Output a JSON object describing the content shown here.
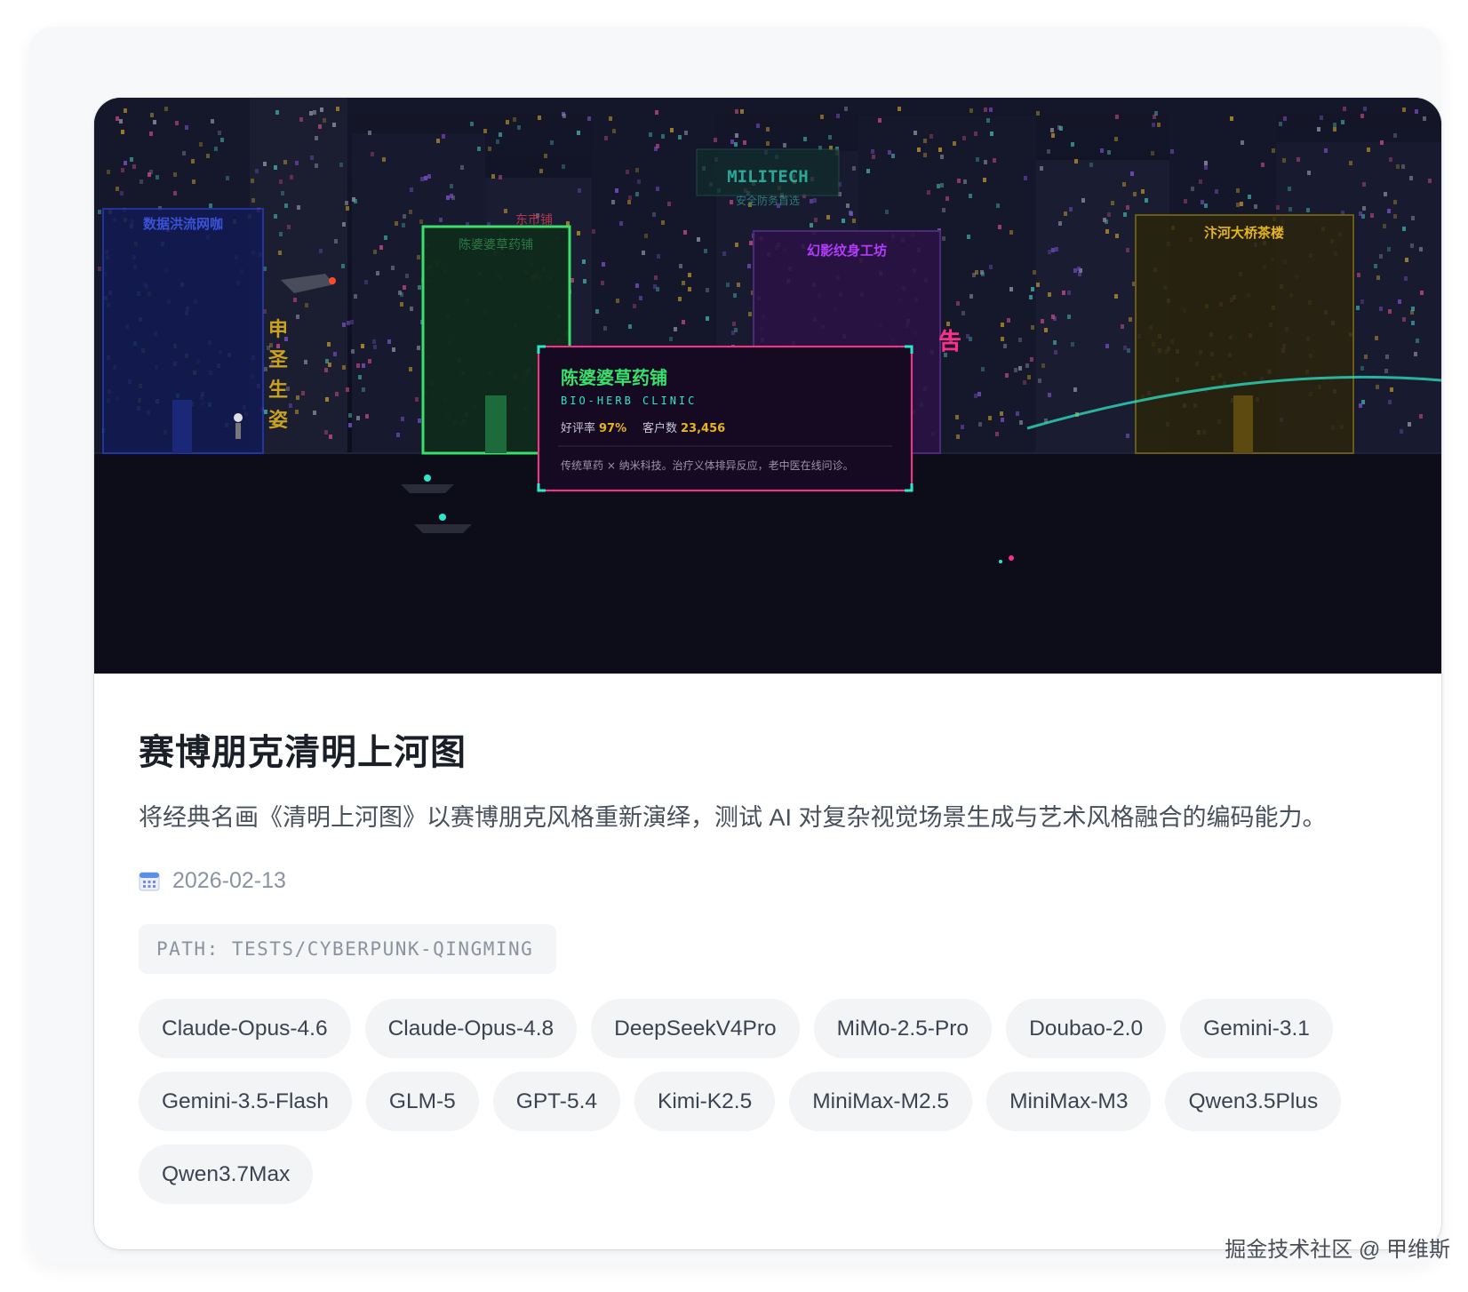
{
  "hero": {
    "signs": {
      "top_banner": "",
      "militech": "MILITECH",
      "militech_sub": "安全防务首选",
      "left_blue": "数据洪流网咖",
      "green_top": "陈婆婆草药铺",
      "green_roof": "东市铺",
      "purple": "幻影纹身工坊",
      "gold": "汴河大桥茶楼",
      "vertical": [
        "申",
        "圣",
        "生",
        "姿"
      ],
      "ad": "告"
    },
    "popup": {
      "title": "陈婆婆草药铺",
      "subtitle": "BIO-HERB CLINIC",
      "rating_label": "好评率",
      "rating_value": "97%",
      "customers_label": "客户数",
      "customers_value": "23,456",
      "description": "传统草药 × 纳米科技。治疗义体排异反应，老中医在线问诊。"
    }
  },
  "title": "赛博朋克清明上河图",
  "description": "将经典名画《清明上河图》以赛博朋克风格重新演绎，测试 AI 对复杂视觉场景生成与艺术风格融合的编码能力。",
  "date_icon": "calendar-icon",
  "date": "2026-02-13",
  "path": "PATH: TESTS/CYBERPUNK-QINGMING",
  "tags": [
    "Claude-Opus-4.6",
    "Claude-Opus-4.8",
    "DeepSeekV4Pro",
    "MiMo-2.5-Pro",
    "Doubao-2.0",
    "Gemini-3.1",
    "Gemini-3.5-Flash",
    "GLM-5",
    "GPT-5.4",
    "Kimi-K2.5",
    "MiniMax-M2.5",
    "MiniMax-M3",
    "Qwen3.5Plus",
    "Qwen3.7Max"
  ],
  "watermark": "掘金技术社区 @ 甲维斯",
  "colors": {
    "neon_green": "#39e06a",
    "neon_pink": "#ff2d8a",
    "neon_cyan": "#2ee6c8",
    "neon_purple": "#b43cff",
    "neon_gold": "#e6b422",
    "neon_blue": "#3a52d8"
  }
}
